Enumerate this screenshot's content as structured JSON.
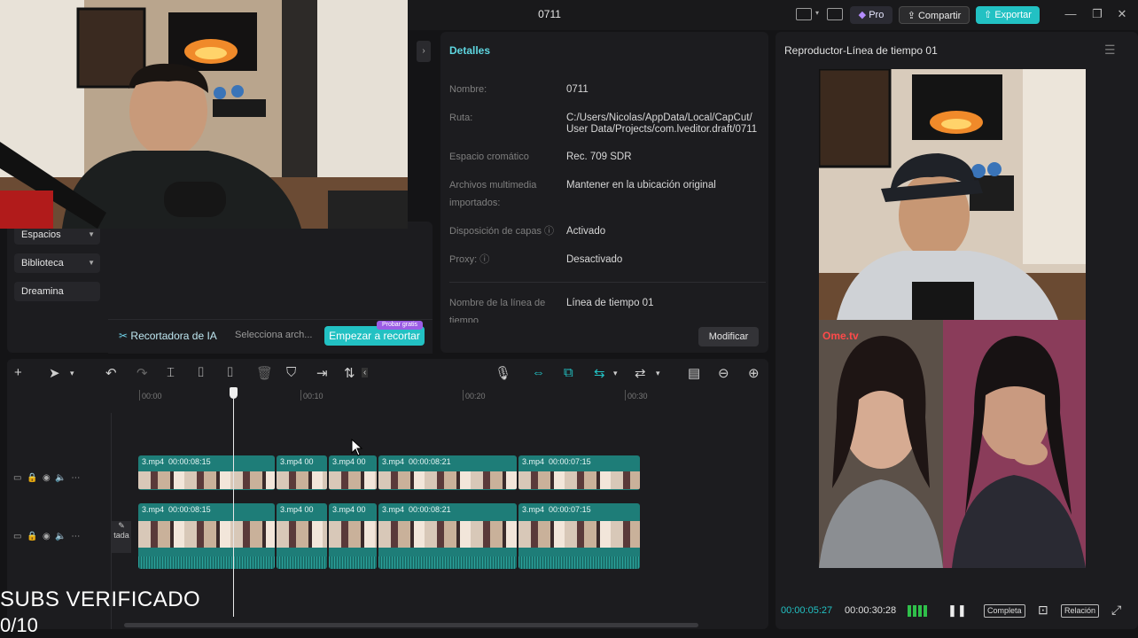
{
  "window": {
    "title": "0711",
    "pro_label": "Pro",
    "share_label": "Compartir",
    "export_label": "Exportar"
  },
  "sidebar": {
    "items": [
      {
        "label": "Espacios",
        "has_caret": true
      },
      {
        "label": "Biblioteca",
        "has_caret": true
      },
      {
        "label": "Dreamina",
        "has_caret": false
      }
    ]
  },
  "ai_cutter": {
    "title": "Recortadora de IA",
    "select_placeholder": "Selecciona arch...",
    "start_label": "Empezar a recortar",
    "trial_badge": "Probar gratis"
  },
  "details": {
    "title": "Detalles",
    "rows": [
      {
        "label": "Nombre:",
        "value": "0711"
      },
      {
        "label": "Ruta:",
        "value": "C:/Users/Nicolas/AppData/Local/CapCut/ User Data/Projects/com.lveditor.draft/0711"
      },
      {
        "label": "Espacio cromático",
        "value": "Rec. 709 SDR"
      },
      {
        "label": "Archivos multimedia importados:",
        "value": "Mantener en la ubicación original"
      },
      {
        "label": "Disposición de capas ⓘ",
        "value": "Activado"
      },
      {
        "label": "Proxy: ⓘ",
        "value": "Desactivado"
      },
      {
        "label": "Nombre de la línea de tiempo",
        "value": "Línea de tiempo 01"
      }
    ],
    "modify_label": "Modificar"
  },
  "player": {
    "title": "Reproductor-Línea de tiempo 01",
    "current_time": "00:00:05:27",
    "total_time": "00:00:30:28",
    "full_label": "Completa",
    "ratio_label": "Relación",
    "overlay_logo": "Ome.tv"
  },
  "timeline": {
    "ruler": [
      "00:00",
      "00:10",
      "00:20",
      "00:30"
    ],
    "track1_clips": [
      {
        "name": "3.mp4",
        "duration": "00:00:08:15"
      },
      {
        "name": "3.mp4",
        "duration": "00"
      },
      {
        "name": "3.mp4",
        "duration": "00"
      },
      {
        "name": "3.mp4",
        "duration": "00:00:08:21"
      },
      {
        "name": "3.mp4",
        "duration": "00:00:07:15"
      }
    ],
    "track2_clips": [
      {
        "name": "3.mp4",
        "duration": "00:00:08:15"
      },
      {
        "name": "3.mp4",
        "duration": "00"
      },
      {
        "name": "3.mp4",
        "duration": "00"
      },
      {
        "name": "3.mp4",
        "duration": "00:00:08:21"
      },
      {
        "name": "3.mp4",
        "duration": "00:00:07:15"
      }
    ],
    "cover_label": "tada"
  },
  "overlay": {
    "line1": "SUBS VERIFICADO",
    "line2": "0/10"
  },
  "colors": {
    "accent": "#22c1c3",
    "clip": "#1e7d78",
    "background": "#141416",
    "panel": "#1c1c1f"
  }
}
